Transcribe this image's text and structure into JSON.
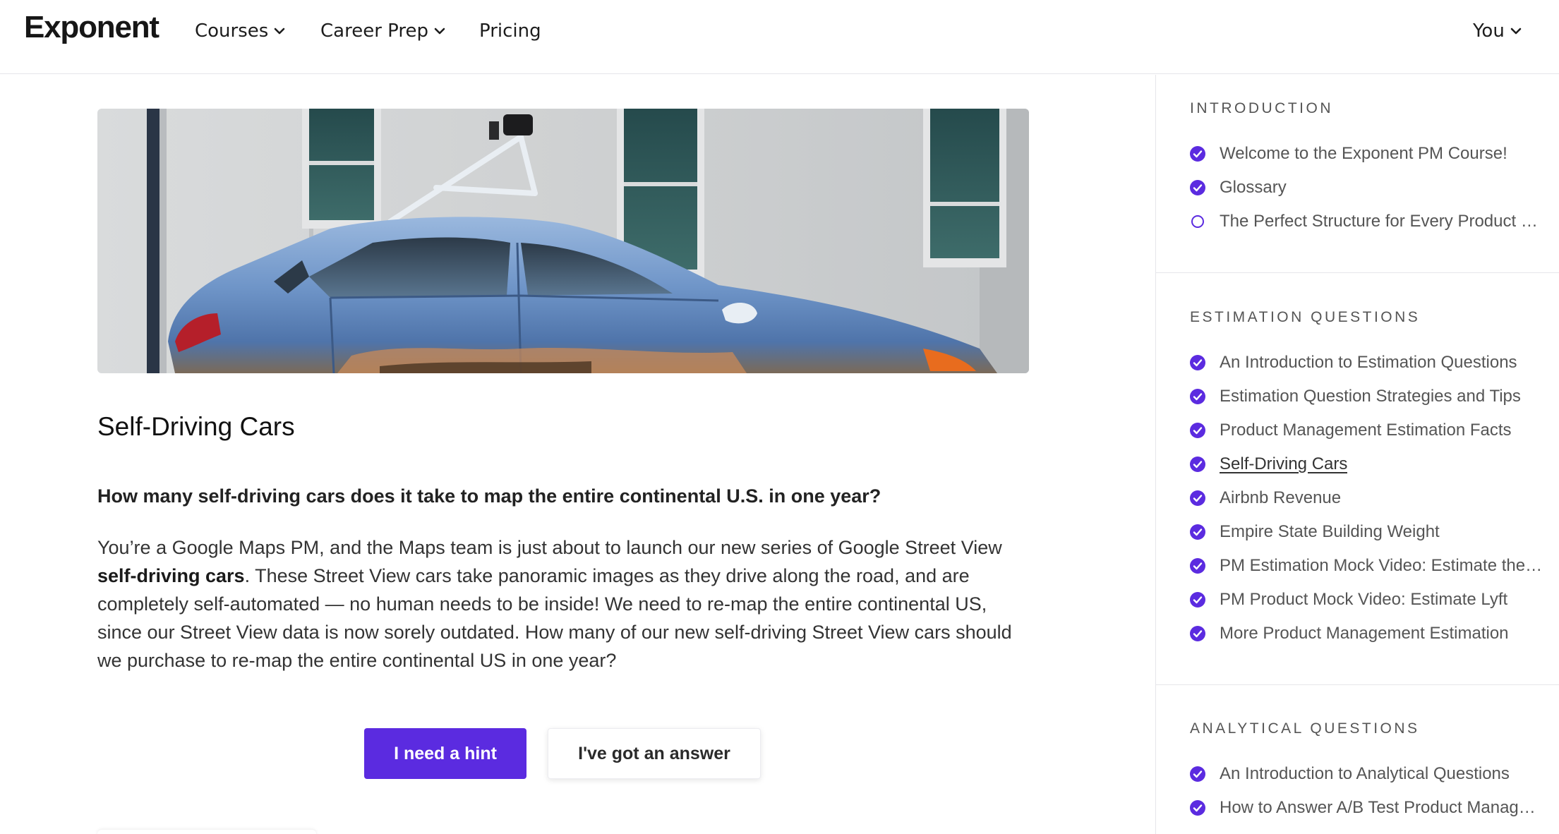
{
  "nav": {
    "logo": "Exponent",
    "courses": "Courses",
    "career_prep": "Career Prep",
    "pricing": "Pricing",
    "user": "You"
  },
  "lesson": {
    "title": "Self-Driving Cars",
    "question": "How many self-driving cars does it take to map the entire continental U.S. in one year?",
    "para_before": "You’re a Google Maps PM, and the Maps team is just about to launch our new series of Google Street View ",
    "para_bold": "self-driving cars",
    "para_after": ". These Street View cars take panoramic images as they drive along the road, and are completely self-automated — no human needs to be inside! We need to re-map the entire continental US, since our Street View data is now sorely outdated. How many of our new self-driving Street View cars should we purchase to re-map the entire continental US in one year?",
    "hint_button": "I need a hint",
    "answer_button": "I've got an answer"
  },
  "sidebar": {
    "sections": [
      {
        "title": "INTRODUCTION",
        "items": [
          {
            "label": "Welcome to the Exponent PM Course!",
            "status": "completed"
          },
          {
            "label": "Glossary",
            "status": "completed"
          },
          {
            "label": "The Perfect Structure for Every Product Question",
            "status": "incomplete"
          }
        ]
      },
      {
        "title": "ESTIMATION QUESTIONS",
        "items": [
          {
            "label": "An Introduction to Estimation Questions",
            "status": "completed"
          },
          {
            "label": "Estimation Question Strategies and Tips",
            "status": "completed"
          },
          {
            "label": "Product Management Estimation Facts",
            "status": "completed"
          },
          {
            "label": "Self-Driving Cars",
            "status": "current"
          },
          {
            "label": "Airbnb Revenue",
            "status": "completed"
          },
          {
            "label": "Empire State Building Weight",
            "status": "completed"
          },
          {
            "label": "PM Estimation Mock Video: Estimate the Number",
            "status": "completed"
          },
          {
            "label": "PM Product Mock Video: Estimate Lyft",
            "status": "completed"
          },
          {
            "label": "More Product Management Estimation",
            "status": "completed"
          }
        ]
      },
      {
        "title": "ANALYTICAL QUESTIONS",
        "items": [
          {
            "label": "An Introduction to Analytical Questions",
            "status": "completed"
          },
          {
            "label": "How to Answer A/B Test Product Management",
            "status": "completed"
          }
        ]
      }
    ]
  },
  "colors": {
    "accent": "#5b2be0",
    "border": "#e6e6ea"
  }
}
